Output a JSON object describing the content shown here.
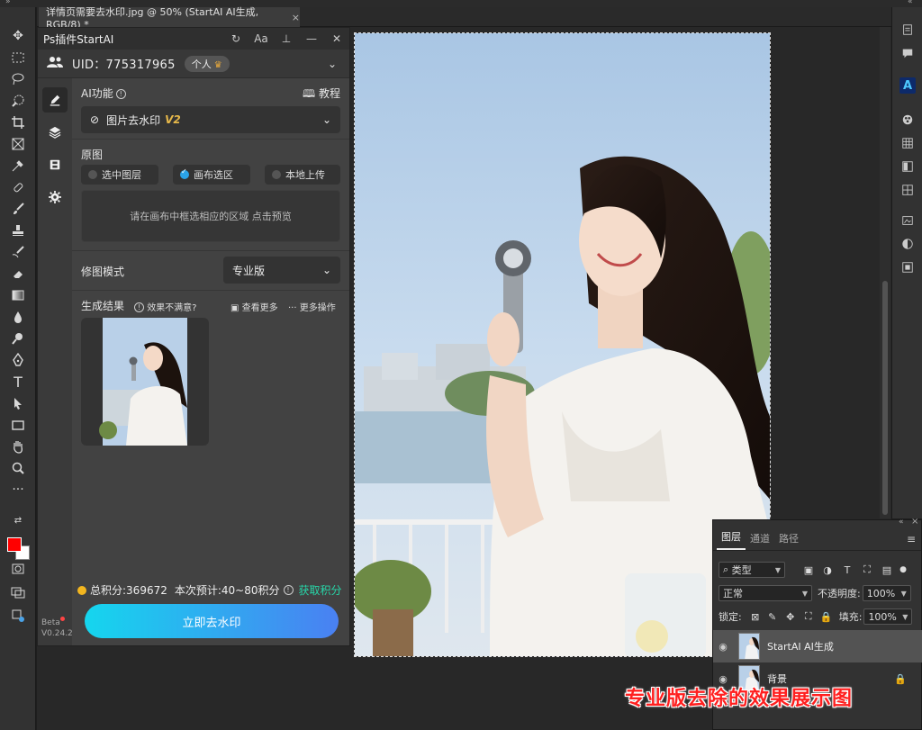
{
  "document": {
    "tab_title": "详情页需要去水印.jpg @ 50% (StartAI AI生成, RGB/8) *",
    "tab_close": "×"
  },
  "plugin": {
    "title": "Ps插件StartAI",
    "header_font_btn": "Aa",
    "uid": "UID：775317965",
    "tier": "个人",
    "ai_function_label": "AI功能",
    "tutorial_label": "教程",
    "feature_select": "图片去水印",
    "feature_version": "V2",
    "source_label": "原图",
    "source_options": [
      {
        "label": "选中图层",
        "checked": false
      },
      {
        "label": "画布选区",
        "checked": true
      },
      {
        "label": "本地上传",
        "checked": false
      }
    ],
    "drop_hint": "请在画布中框选相应的区域 点击预览",
    "mode_label": "修图模式",
    "mode_select": "专业版",
    "result_label": "生成结果",
    "unsatisfied": "效果不满意?",
    "view_more": "查看更多",
    "more_actions": "更多操作",
    "points": "总积分:369672",
    "estimate": "本次预计:40~80积分",
    "earn_points": "获取积分",
    "primary_button": "立即去水印",
    "beta": "Beta",
    "version": "V0.24.2"
  },
  "layers": {
    "tabs": [
      {
        "label": "图层",
        "active": true
      },
      {
        "label": "通道",
        "active": false
      },
      {
        "label": "路径",
        "active": false
      }
    ],
    "filter_kind": "类型",
    "blend_mode": "正常",
    "opacity_label": "不透明度:",
    "opacity_value": "100%",
    "lock_label": "锁定:",
    "fill_label": "填充:",
    "fill_value": "100%",
    "items": [
      {
        "name": "StartAI AI生成",
        "selected": true,
        "locked": false
      },
      {
        "name": "背景",
        "selected": false,
        "locked": true
      }
    ]
  },
  "caption": "专业版去除的效果展示图",
  "colors": {
    "foreground": "#ff0000",
    "background": "#ffffff",
    "primary_gradient_start": "#15d6ee",
    "primary_gradient_end": "#4a80f2",
    "earn": "#27d6a8",
    "caption": "#ff1f1f"
  }
}
